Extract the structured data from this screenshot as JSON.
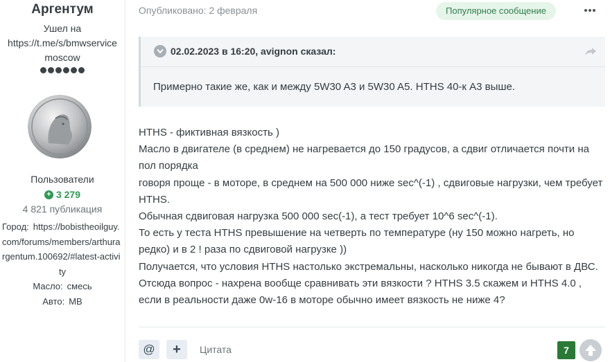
{
  "author": {
    "name": "Аргентум",
    "status_lines": [
      "Ушел на",
      "https://t.me/s/bmwservice",
      "moscow"
    ],
    "rank_pips": 6,
    "group": "Пользователи",
    "reputation": "3 279",
    "posts": "4 821 публикация",
    "fields": [
      {
        "label": "Город:",
        "value": "https://bobistheoilguy.com/forums/members/arthurargentum.100692/#latest-activity"
      },
      {
        "label": "Масло:",
        "value": "смесь"
      },
      {
        "label": "Авто:",
        "value": "MB"
      }
    ]
  },
  "post": {
    "published": "Опубликовано: 2 февраля",
    "badge": "Популярное сообщение",
    "quote": {
      "cite": "02.02.2023 в 16:20, avignon сказал:",
      "text": "Примерно такие же, как и между 5W30 A3 и 5W30 A5. HTHS 40-к A3 выше."
    },
    "lines": [
      "HTHS - фиктивная вязкость )",
      "Масло в двигателе (в среднем) не нагревается до 150 градусов, а сдвиг отличается почти на пол порядка",
      "говоря проще - в моторе, в среднем на 500 000 ниже sec^(-1) , сдвиговые нагрузки, чем требует HTHS.",
      "Обычная сдвиговая нагрузка 500 000 sec(-1), а тест требует 10^6 sec^(-1).",
      "То есть у теста HTHS превышение на четверть по температуре (ну 150 можно нагреть, но редко) и в 2 ! раза по сдвиговой нагрузке ))",
      "Получается, что условия HTHS настолько экстремальны, насколько никогда не бывают в ДВС. Отсюда вопрос - нахрена вообще сравнивать эти вязкости ? HTHS 3.5 скажем и HTHS 4.0 , если в реальности даже 0w-16 в моторе обычно имеет вязкость не ниже 4?"
    ]
  },
  "footer": {
    "mention_glyph": "@",
    "plus_glyph": "+",
    "quote_label": "Цитата",
    "score": "7"
  },
  "icons": {
    "reputation": "plus-circle-icon",
    "quote_toggle": "chevron-down-icon",
    "quote_share": "share-arrow-icon",
    "menu": "more-dots-icon",
    "vote": "arrow-up-icon"
  },
  "colors": {
    "reputation": "#2c9a52",
    "badge_bg": "#e6f5ea",
    "badge_text": "#2f7d4a",
    "score_bg": "#2a7a36",
    "quote_bg": "#f3f5f7"
  }
}
